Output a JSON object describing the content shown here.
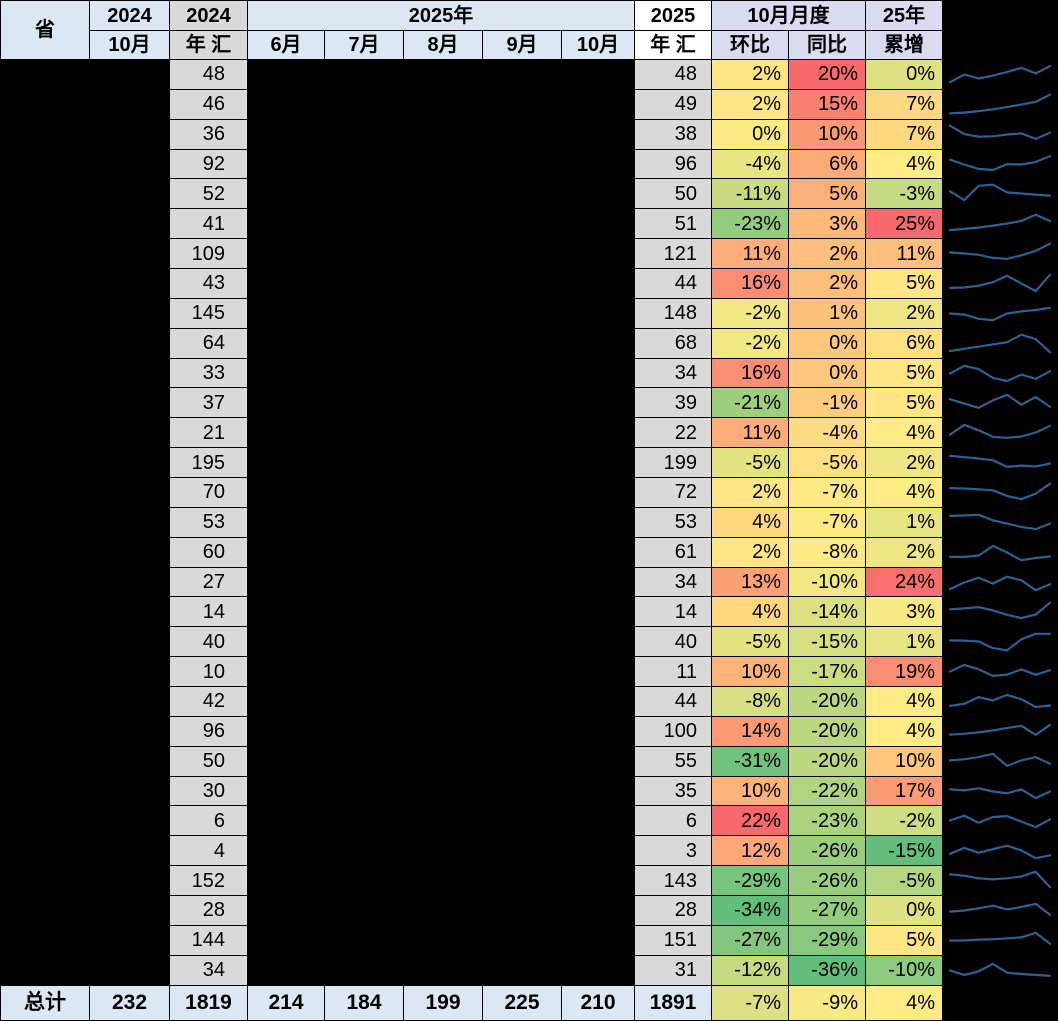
{
  "header": {
    "province": "省",
    "y2024_oct_top": "2024",
    "y2024_oct_sub": "10月",
    "y2024_total_top": "2024",
    "y2024_total_sub": "年 汇",
    "y2025_group": "2025年",
    "months": [
      "6月",
      "7月",
      "8月",
      "9月",
      "10月"
    ],
    "y2025_total_top": "2025",
    "y2025_total_sub": "年 汇",
    "oct_group": "10月月度",
    "mom": "环比",
    "yoy": "同比",
    "cum_top": "25年",
    "cum_sub": "累增"
  },
  "colors": {
    "header_blue": "#dbe7f3",
    "header_gray": "#d9d9d9",
    "header_lavender": "#d9dcf0",
    "header_white": "#ffffff",
    "value_gray": "#d9d9d9",
    "total_blue": "#dbe7f3",
    "redacted_black": "#000000",
    "border": "#000000",
    "sparkline": "#2e6191"
  },
  "heatmap": {
    "low": "#63be7b",
    "mid": "#ffeb84",
    "high": "#f8696b",
    "scales": {
      "mom": {
        "min": -34,
        "mid": 1,
        "max": 22
      },
      "yoy": {
        "min": -36,
        "mid": -7.5,
        "max": 20
      },
      "cum": {
        "min": -15,
        "mid": 4,
        "max": 25
      }
    }
  },
  "chart_data": {
    "type": "table",
    "note": "sparkline point values are approximate normalized shapes (0=bottom,1=top)"
  },
  "rows": [
    {
      "y2024": 48,
      "y2025": 48,
      "mom": 2,
      "yoy": 20,
      "cum": 0,
      "spark": [
        0.15,
        0.5,
        0.32,
        0.45,
        0.62,
        0.8,
        0.55,
        0.88
      ]
    },
    {
      "y2024": 46,
      "y2025": 49,
      "mom": 2,
      "yoy": 15,
      "cum": 7,
      "spark": [
        0.1,
        0.13,
        0.2,
        0.28,
        0.38,
        0.5,
        0.62,
        0.95
      ]
    },
    {
      "y2024": 36,
      "y2025": 38,
      "mom": 0,
      "yoy": 10,
      "cum": 7,
      "spark": [
        0.9,
        0.52,
        0.4,
        0.42,
        0.5,
        0.55,
        0.3,
        0.58
      ]
    },
    {
      "y2024": 92,
      "y2025": 96,
      "mom": -4,
      "yoy": 6,
      "cum": 4,
      "spark": [
        0.72,
        0.5,
        0.3,
        0.25,
        0.52,
        0.5,
        0.62,
        0.88
      ]
    },
    {
      "y2024": 52,
      "y2025": 50,
      "mom": -11,
      "yoy": 5,
      "cum": -3,
      "spark": [
        0.6,
        0.2,
        0.85,
        0.9,
        0.55,
        0.5,
        0.45,
        0.4
      ]
    },
    {
      "y2024": 41,
      "y2025": 51,
      "mom": -23,
      "yoy": 3,
      "cum": 25,
      "spark": [
        0.2,
        0.26,
        0.32,
        0.4,
        0.5,
        0.62,
        0.9,
        0.62
      ]
    },
    {
      "y2024": 109,
      "y2025": 121,
      "mom": 11,
      "yoy": 2,
      "cum": 11,
      "spark": [
        0.55,
        0.5,
        0.44,
        0.3,
        0.26,
        0.42,
        0.62,
        0.95
      ]
    },
    {
      "y2024": 43,
      "y2025": 44,
      "mom": 16,
      "yoy": 2,
      "cum": 5,
      "spark": [
        0.3,
        0.32,
        0.4,
        0.56,
        0.85,
        0.5,
        0.15,
        0.9
      ]
    },
    {
      "y2024": 145,
      "y2025": 148,
      "mom": -2,
      "yoy": 1,
      "cum": 2,
      "spark": [
        0.5,
        0.45,
        0.26,
        0.2,
        0.5,
        0.6,
        0.66,
        0.76
      ]
    },
    {
      "y2024": 64,
      "y2025": 68,
      "mom": -2,
      "yoy": 0,
      "cum": 6,
      "spark": [
        0.16,
        0.26,
        0.36,
        0.46,
        0.56,
        0.9,
        0.7,
        0.1
      ]
    },
    {
      "y2024": 33,
      "y2025": 34,
      "mom": 16,
      "yoy": 0,
      "cum": 5,
      "spark": [
        0.5,
        0.85,
        0.7,
        0.3,
        0.16,
        0.45,
        0.26,
        0.6
      ]
    },
    {
      "y2024": 37,
      "y2025": 39,
      "mom": -21,
      "yoy": -1,
      "cum": 5,
      "spark": [
        0.65,
        0.45,
        0.26,
        0.6,
        0.85,
        0.4,
        0.75,
        0.3
      ]
    },
    {
      "y2024": 21,
      "y2025": 22,
      "mom": 11,
      "yoy": -4,
      "cum": 4,
      "spark": [
        0.4,
        0.85,
        0.6,
        0.3,
        0.26,
        0.32,
        0.5,
        0.8
      ]
    },
    {
      "y2024": 195,
      "y2025": 199,
      "mom": -5,
      "yoy": -5,
      "cum": 2,
      "spark": [
        0.8,
        0.74,
        0.68,
        0.6,
        0.3,
        0.36,
        0.32,
        0.45
      ]
    },
    {
      "y2024": 70,
      "y2025": 72,
      "mom": 2,
      "yoy": -7,
      "cum": 4,
      "spark": [
        0.7,
        0.68,
        0.64,
        0.6,
        0.34,
        0.2,
        0.45,
        0.9
      ]
    },
    {
      "y2024": 53,
      "y2025": 53,
      "mom": 4,
      "yoy": -7,
      "cum": 1,
      "spark": [
        0.8,
        0.82,
        0.85,
        0.6,
        0.45,
        0.3,
        0.2,
        0.45
      ]
    },
    {
      "y2024": 60,
      "y2025": 61,
      "mom": 2,
      "yoy": -8,
      "cum": 2,
      "spark": [
        0.3,
        0.3,
        0.36,
        0.8,
        0.5,
        0.15,
        0.25,
        0.32
      ]
    },
    {
      "y2024": 27,
      "y2025": 34,
      "mom": 13,
      "yoy": -10,
      "cum": 24,
      "spark": [
        0.2,
        0.5,
        0.72,
        0.45,
        0.76,
        0.6,
        0.15,
        0.42
      ]
    },
    {
      "y2024": 14,
      "y2025": 14,
      "mom": 4,
      "yoy": -14,
      "cum": 3,
      "spark": [
        0.6,
        0.64,
        0.7,
        0.55,
        0.35,
        0.2,
        0.36,
        0.9
      ]
    },
    {
      "y2024": 40,
      "y2025": 40,
      "mom": -5,
      "yoy": -15,
      "cum": 1,
      "spark": [
        0.55,
        0.54,
        0.5,
        0.2,
        0.1,
        0.6,
        0.85,
        0.85
      ]
    },
    {
      "y2024": 10,
      "y2025": 11,
      "mom": 10,
      "yoy": -17,
      "cum": 19,
      "spark": [
        0.5,
        0.8,
        0.6,
        0.3,
        0.36,
        0.6,
        0.35,
        0.56
      ]
    },
    {
      "y2024": 42,
      "y2025": 44,
      "mom": -8,
      "yoy": -20,
      "cum": 4,
      "spark": [
        0.3,
        0.4,
        0.7,
        0.55,
        0.8,
        0.6,
        0.25,
        0.32
      ]
    },
    {
      "y2024": 96,
      "y2025": 100,
      "mom": 14,
      "yoy": -20,
      "cum": 4,
      "spark": [
        0.36,
        0.4,
        0.46,
        0.55,
        0.66,
        0.76,
        0.35,
        0.8
      ]
    },
    {
      "y2024": 50,
      "y2025": 55,
      "mom": -31,
      "yoy": -20,
      "cum": 10,
      "spark": [
        0.55,
        0.6,
        0.7,
        0.85,
        0.3,
        0.55,
        0.7,
        0.4
      ]
    },
    {
      "y2024": 30,
      "y2025": 35,
      "mom": 10,
      "yoy": -22,
      "cum": 17,
      "spark": [
        0.6,
        0.55,
        0.65,
        0.5,
        0.42,
        0.6,
        0.2,
        0.5
      ]
    },
    {
      "y2024": 6,
      "y2025": 6,
      "mom": 22,
      "yoy": -23,
      "cum": -2,
      "spark": [
        0.5,
        0.72,
        0.4,
        0.66,
        0.7,
        0.45,
        0.2,
        0.55
      ]
    },
    {
      "y2024": 4,
      "y2025": 3,
      "mom": 12,
      "yoy": -26,
      "cum": -15,
      "spark": [
        0.35,
        0.62,
        0.4,
        0.56,
        0.72,
        0.5,
        0.15,
        0.28
      ]
    },
    {
      "y2024": 152,
      "y2025": 143,
      "mom": -29,
      "yoy": -26,
      "cum": -5,
      "spark": [
        0.78,
        0.72,
        0.6,
        0.55,
        0.6,
        0.68,
        0.9,
        0.2
      ]
    },
    {
      "y2024": 28,
      "y2025": 28,
      "mom": -34,
      "yoy": -27,
      "cum": 0,
      "spark": [
        0.45,
        0.5,
        0.6,
        0.72,
        0.55,
        0.66,
        0.8,
        0.3
      ]
    },
    {
      "y2024": 144,
      "y2025": 151,
      "mom": -27,
      "yoy": -29,
      "cum": 5,
      "spark": [
        0.5,
        0.5,
        0.54,
        0.56,
        0.6,
        0.64,
        0.85,
        0.35
      ]
    },
    {
      "y2024": 34,
      "y2025": 31,
      "mom": -12,
      "yoy": -36,
      "cum": -10,
      "spark": [
        0.5,
        0.3,
        0.46,
        0.8,
        0.4,
        0.34,
        0.3,
        0.26
      ]
    }
  ],
  "total": {
    "label": "总计",
    "oct2024": 232,
    "y2024": 1819,
    "months": [
      214,
      184,
      199,
      225,
      210
    ],
    "y2025": 1891,
    "mom": -7,
    "yoy": -9,
    "cum": 4
  }
}
